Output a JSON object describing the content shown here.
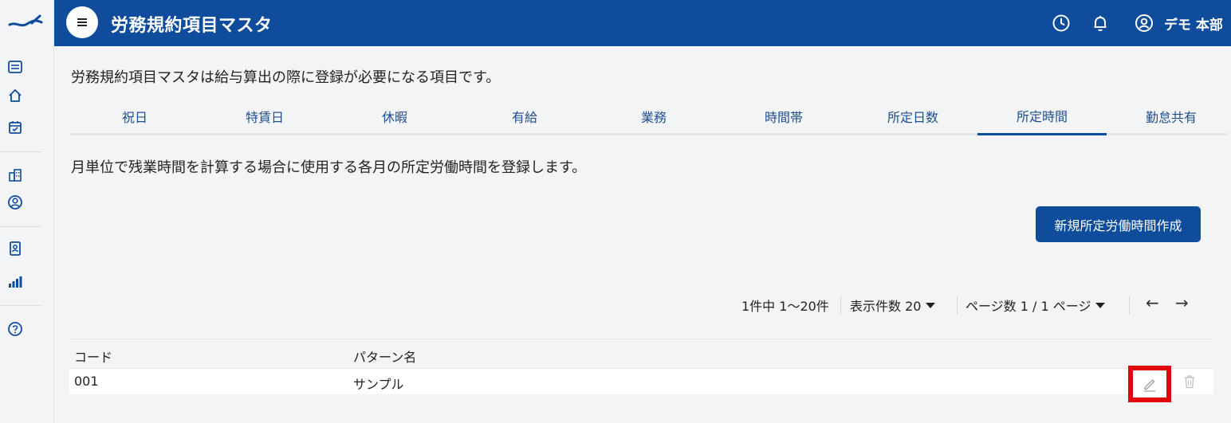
{
  "sidebar": {
    "icons": [
      "list-icon",
      "home-icon",
      "calendar-check-icon",
      "building-icon",
      "user-circle-icon",
      "id-badge-icon",
      "bar-chart-icon",
      "help-icon"
    ]
  },
  "header": {
    "title": "労務規約項目マスタ",
    "user_name": "デモ 本部",
    "icons": [
      "history-icon",
      "bell-icon",
      "user-icon"
    ],
    "bg_color": "#0f4c9b"
  },
  "intro_text": "労務規約項目マスタは給与算出の際に登録が必要になる項目です。",
  "tabs": [
    {
      "label": "祝日"
    },
    {
      "label": "特賃日"
    },
    {
      "label": "休暇"
    },
    {
      "label": "有給"
    },
    {
      "label": "業務"
    },
    {
      "label": "時間帯"
    },
    {
      "label": "所定日数"
    },
    {
      "label": "所定時間"
    },
    {
      "label": "勤怠共有"
    }
  ],
  "active_tab": "所定時間",
  "description": "月単位で残業時間を計算する場合に使用する各月の所定労働時間を登録します。",
  "create_button": "新規所定労働時間作成",
  "pager": {
    "range": "1件中 1〜20件",
    "per_page": "表示件数 20",
    "page": "ページ数 1 / 1 ページ",
    "prev": "←",
    "next": "→"
  },
  "table": {
    "columns": [
      "コード",
      "パターン名"
    ],
    "rows": [
      {
        "code": "001",
        "name": "サンプル"
      }
    ]
  },
  "highlight_color": "#e0060b"
}
